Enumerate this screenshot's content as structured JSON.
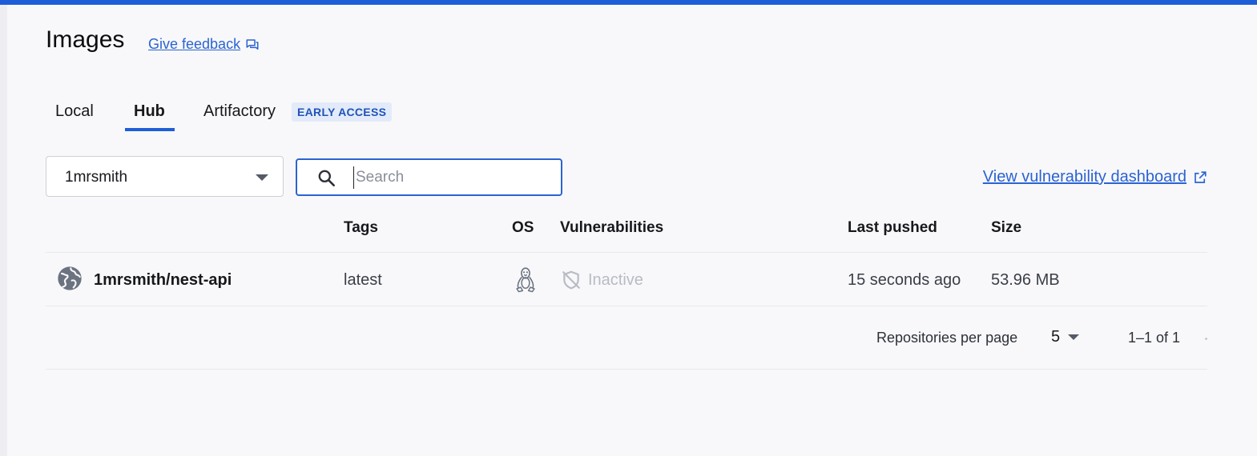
{
  "header": {
    "title": "Images",
    "feedback_label": "Give feedback"
  },
  "tabs": [
    {
      "label": "Local",
      "active": false
    },
    {
      "label": "Hub",
      "active": true
    },
    {
      "label": "Artifactory",
      "active": false,
      "badge": "EARLY ACCESS"
    }
  ],
  "toolbar": {
    "org_select_value": "1mrsmith",
    "search_placeholder": "Search",
    "vuln_dashboard_label": "View vulnerability dashboard"
  },
  "table": {
    "columns": [
      "Tags",
      "OS",
      "Vulnerabilities",
      "Last pushed",
      "Size"
    ],
    "rows": [
      {
        "name": "1mrsmith/nest-api",
        "tag": "latest",
        "os_icon": "linux-icon",
        "vulnerabilities": "Inactive",
        "last_pushed": "15 seconds ago",
        "size": "53.96 MB"
      }
    ]
  },
  "pagination": {
    "per_page_label": "Repositories per page",
    "per_page_value": "5",
    "range": "1–1 of 1"
  },
  "colors": {
    "accent": "#1d5ed8",
    "link": "#2b63d1",
    "badge_bg": "#e3ebfa",
    "inactive": "#b8bbc3"
  }
}
